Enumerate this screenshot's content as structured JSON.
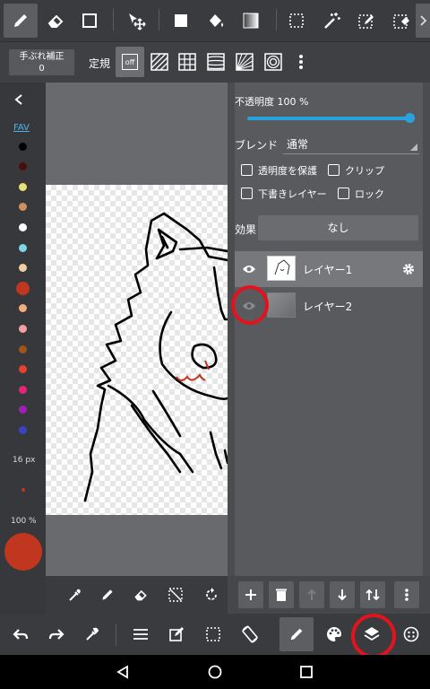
{
  "toolbar_sub": {
    "stabilizer_label": "手ぶれ補正",
    "stabilizer_value": "0",
    "ruler_label": "定規",
    "ruler_off": "off"
  },
  "palette": {
    "fav_label": "FAV",
    "colors": [
      "#000000",
      "#4a0e0e",
      "#e8e070",
      "#d2905e",
      "#ffffff",
      "#7ad8ea",
      "#f4ceA0",
      "#c1361f",
      "#f1ad7b",
      "#f4a0a0",
      "#a05418",
      "#e8402e",
      "#e8237a",
      "#a020b5",
      "#3c43c0"
    ],
    "brush_size": "16 px",
    "opacity": "100 %",
    "current_color": "#c1361f"
  },
  "layer_panel": {
    "opacity_label": "不透明度 100 %",
    "opacity_value": 1.0,
    "blend_label": "ブレンド",
    "blend_value": "通常",
    "protect_alpha": "透明度を保護",
    "clip": "クリップ",
    "draft_layer": "下書きレイヤー",
    "lock": "ロック",
    "effect_label": "効果",
    "effect_value": "なし",
    "layers": [
      {
        "name": "レイヤー1",
        "visible": true
      },
      {
        "name": "レイヤー2",
        "visible": false
      }
    ]
  },
  "icons": {
    "top": [
      "pen-icon",
      "eraser-icon",
      "rectangle-icon",
      "move-icon",
      "fill-square-icon",
      "bucket-icon",
      "gradient-icon",
      "select-rect-icon",
      "magic-wand-icon",
      "select-pen-icon",
      "select-eraser-icon"
    ],
    "accent": "#29a3e0",
    "highlight": "#e3131e"
  }
}
